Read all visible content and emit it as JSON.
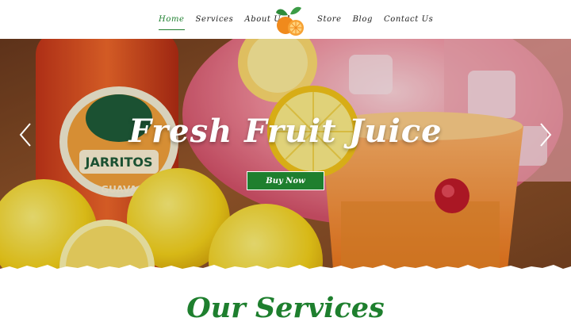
{
  "nav": {
    "left": [
      "Home",
      "Services",
      "About Us"
    ],
    "right": [
      "Store",
      "Blog",
      "Contact Us"
    ],
    "active": "Home"
  },
  "hero": {
    "title": "Fresh Fruit Juice",
    "button_label": "Buy Now",
    "bottle_brand": "JARRITOS",
    "bottle_flavor": "GUAVA"
  },
  "services": {
    "heading": "Our Services"
  },
  "colors": {
    "accent": "#1e7f2e",
    "orange": "#f08a1c",
    "leaf": "#2e8b3a"
  },
  "icons": [
    "logo-icon",
    "chevron-left-icon",
    "chevron-right-icon"
  ]
}
